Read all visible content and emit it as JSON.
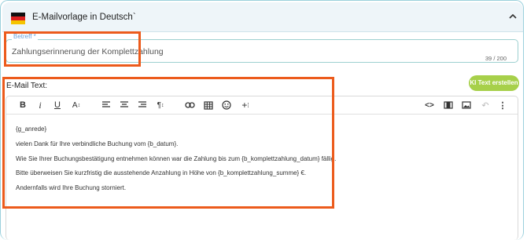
{
  "accordion": {
    "title": "E-Mailvorlage in Deutsch",
    "title_suffix": "`",
    "flag_colors": [
      "#111111",
      "#dd2020",
      "#f5c400"
    ]
  },
  "subject": {
    "label": "Betreff *",
    "value": "Zahlungserinnerung der Komplettzahlung",
    "counter": "39 / 200"
  },
  "email": {
    "label": "E-Mail Text:",
    "ai_button": "KI Text erstellen"
  },
  "toolbar": {
    "left": [
      "bold-icon",
      "italic-icon",
      "underline-icon",
      "font-size-icon",
      "align-left-icon",
      "align-center-icon",
      "align-right-icon",
      "paragraph-icon",
      "link-icon",
      "table-icon",
      "emoji-icon",
      "insert-icon"
    ],
    "right": [
      "code-icon",
      "video-icon",
      "image-icon",
      "undo-icon",
      "more-icon"
    ]
  },
  "body": {
    "lines": [
      "{g_anrede}",
      "vielen Dank für Ihre verbindliche Buchung vom {b_datum}.",
      "Wie Sie Ihrer Buchungsbestätigung entnehmen können war die Zahlung bis zum {b_komplettzahlung_datum} fällig.",
      "Bitte überweisen Sie kurzfristig die ausstehende Anzahlung in Höhe von {b_komplettzahlung_summe} €.",
      "Andernfalls wird Ihre Buchung storniert."
    ]
  },
  "colors": {
    "highlight": "#ec5b1c",
    "accent": "#a7d04a",
    "border": "#9ad0dc"
  }
}
